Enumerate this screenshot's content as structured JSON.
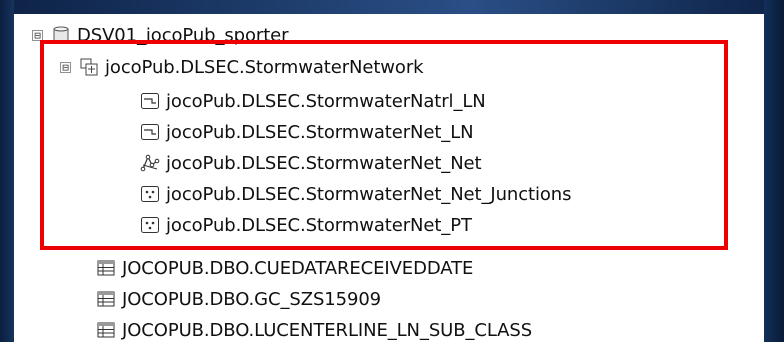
{
  "tree": {
    "database": {
      "label": "DSV01_jocoPub_sporter",
      "expander": "⊟",
      "icon": "database-icon"
    },
    "dataset": {
      "label": "jocoPub.DLSEC.StormwaterNetwork",
      "expander": "⊟",
      "icon": "feature-dataset-icon"
    },
    "dataset_children": [
      {
        "label": "jocoPub.DLSEC.StormwaterNatrl_LN",
        "icon": "line-feature-class-icon"
      },
      {
        "label": "jocoPub.DLSEC.StormwaterNet_LN",
        "icon": "line-feature-class-icon"
      },
      {
        "label": "jocoPub.DLSEC.StormwaterNet_Net",
        "icon": "geometric-network-icon"
      },
      {
        "label": "jocoPub.DLSEC.StormwaterNet_Net_Junctions",
        "icon": "point-feature-class-icon"
      },
      {
        "label": "jocoPub.DLSEC.StormwaterNet_PT",
        "icon": "point-feature-class-icon"
      }
    ],
    "tables": [
      {
        "label": "JOCOPUB.DBO.CUEDATARECEIVEDDATE",
        "icon": "table-icon"
      },
      {
        "label": "JOCOPUB.DBO.GC_SZS15909",
        "icon": "table-icon"
      },
      {
        "label": "JOCOPUB.DBO.LUCENTERLINE_LN_SUB_CLASS",
        "icon": "table-icon"
      }
    ]
  },
  "highlight_color": "#ee0000"
}
